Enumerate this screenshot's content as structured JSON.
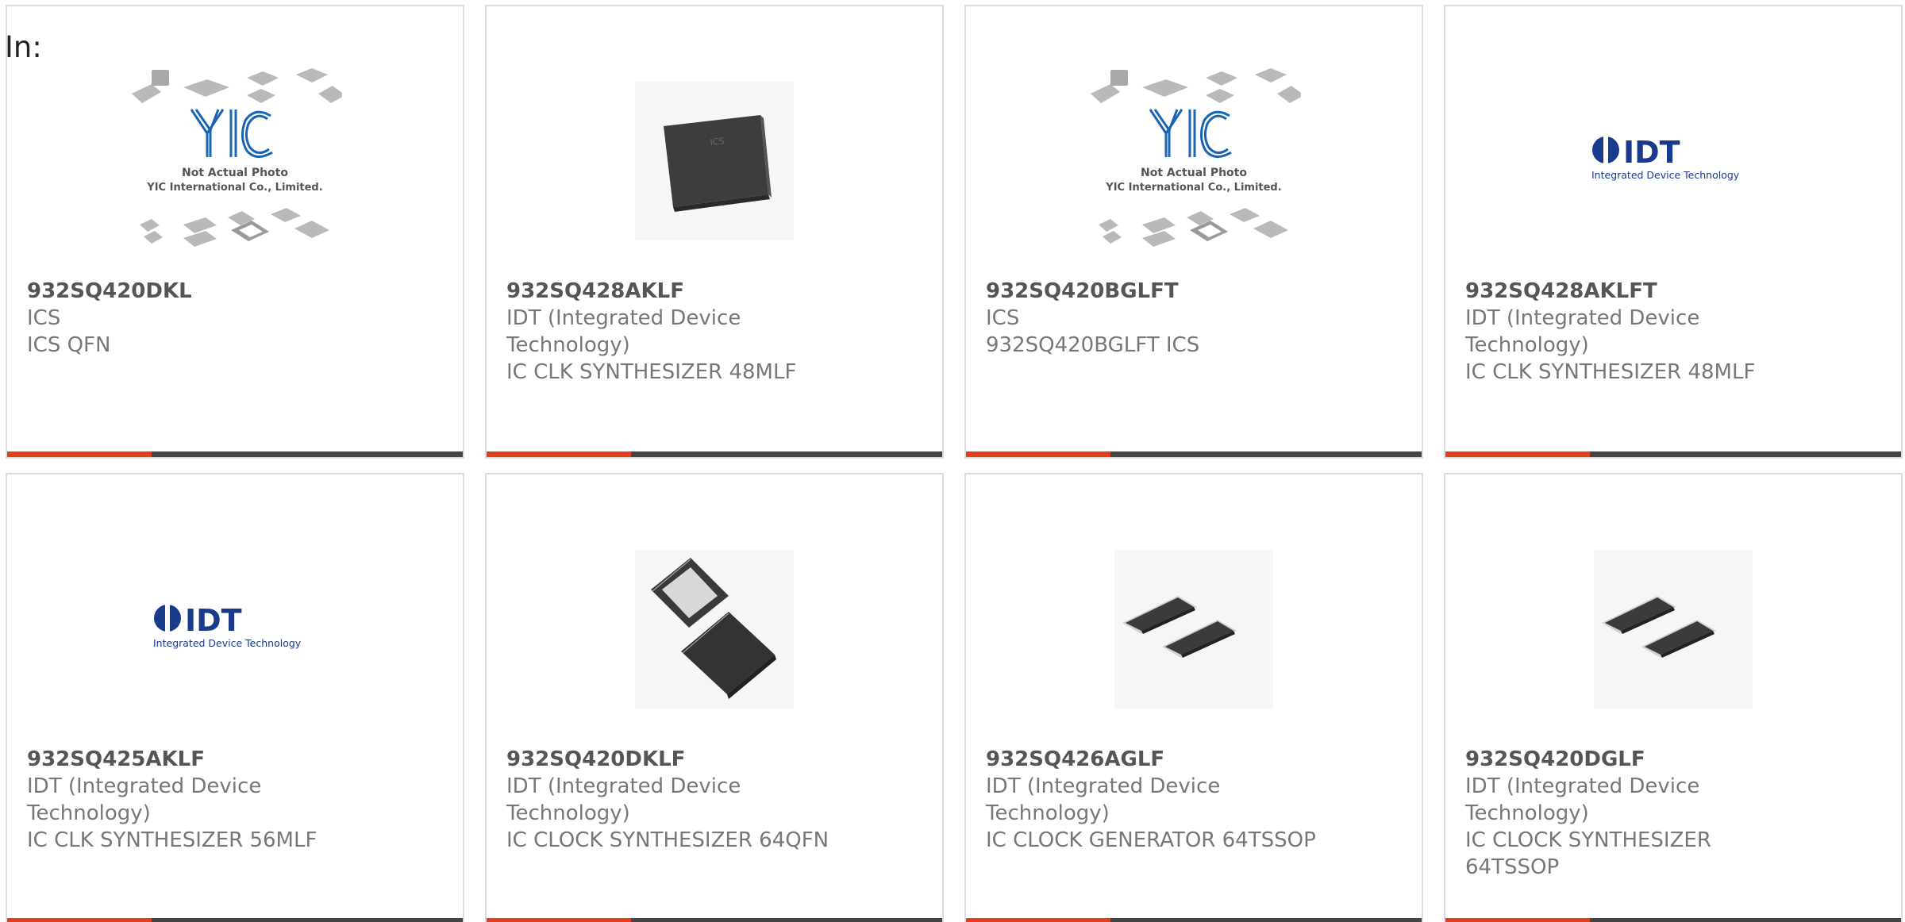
{
  "filter": {
    "label": "In:"
  },
  "accent_color": "#e2401c",
  "bar_color": "#444444",
  "products": [
    {
      "part": "932SQ420DKL",
      "manufacturer": "ICS",
      "description": "ICS QFN",
      "image": "yic-not-actual-photo-icon"
    },
    {
      "part": "932SQ428AKLF",
      "manufacturer": "IDT (Integrated Device Technology)",
      "description": "IC CLK SYNTHESIZER 48MLF",
      "image": "qfn-chip-icon"
    },
    {
      "part": "932SQ420BGLFT",
      "manufacturer": "ICS",
      "description": "932SQ420BGLFT ICS",
      "image": "yic-not-actual-photo-icon"
    },
    {
      "part": "932SQ428AKLFT",
      "manufacturer": "IDT (Integrated Device Technology)",
      "description": "IC CLK SYNTHESIZER 48MLF",
      "image": "idt-logo-icon"
    },
    {
      "part": "932SQ425AKLF",
      "manufacturer": "IDT (Integrated Device Technology)",
      "description": "IC CLK SYNTHESIZER 56MLF",
      "image": "idt-logo-icon"
    },
    {
      "part": "932SQ420DKLF",
      "manufacturer": "IDT (Integrated Device Technology)",
      "description": "IC CLOCK SYNTHESIZER 64QFN",
      "image": "qfn64-chip-icon"
    },
    {
      "part": "932SQ426AGLF",
      "manufacturer": "IDT (Integrated Device Technology)",
      "description": "IC CLOCK GENERATOR 64TSSOP",
      "image": "tssop-chip-icon"
    },
    {
      "part": "932SQ420DGLF",
      "manufacturer": "IDT (Integrated Device Technology)",
      "description": "IC CLOCK SYNTHESIZER 64TSSOP",
      "image": "tssop-chip-icon"
    }
  ],
  "yic_image": {
    "brand": "YIC",
    "line1": "Not Actual Photo",
    "line2": "YIC International Co., Limited."
  },
  "idt_image": {
    "brand": "IDT",
    "tagline": "Integrated Device Technology"
  },
  "chip_image": {
    "marking": "ICS"
  }
}
